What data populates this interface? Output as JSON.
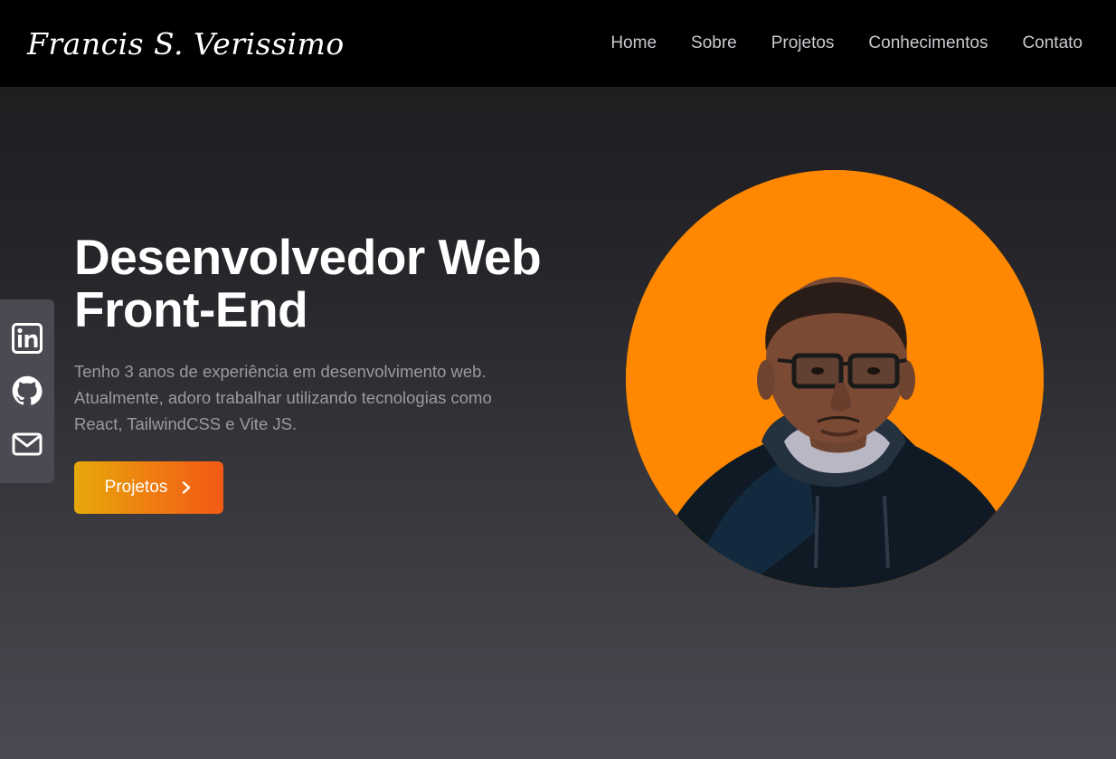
{
  "brand": {
    "name": "Francis S. Verissimo"
  },
  "nav": {
    "items": [
      {
        "label": "Home"
      },
      {
        "label": "Sobre"
      },
      {
        "label": "Projetos"
      },
      {
        "label": "Conhecimentos"
      },
      {
        "label": "Contato"
      }
    ]
  },
  "social": {
    "items": [
      {
        "icon": "linkedin-icon"
      },
      {
        "icon": "github-icon"
      },
      {
        "icon": "mail-icon"
      }
    ]
  },
  "hero": {
    "title_line1": "Desenvolvedor Web",
    "title_line2": "Front-End",
    "description": "Tenho 3 anos de experiência em desenvolvimento web. Atualmente, adoro trabalhar utilizando tecnologias como React, TailwindCSS e Vite JS.",
    "cta_label": "Projetos",
    "cta_icon": "chevron-right-icon"
  },
  "avatar": {
    "icon": "profile-photo"
  },
  "colors": {
    "accent": "#ff8800",
    "cta_start": "#e6a90a",
    "cta_end": "#f25a14",
    "navbar_bg": "#000000",
    "nav_text": "#c9c9cf",
    "muted_text": "#9a9aa2",
    "social_bar_bg": "#4a4a52"
  }
}
